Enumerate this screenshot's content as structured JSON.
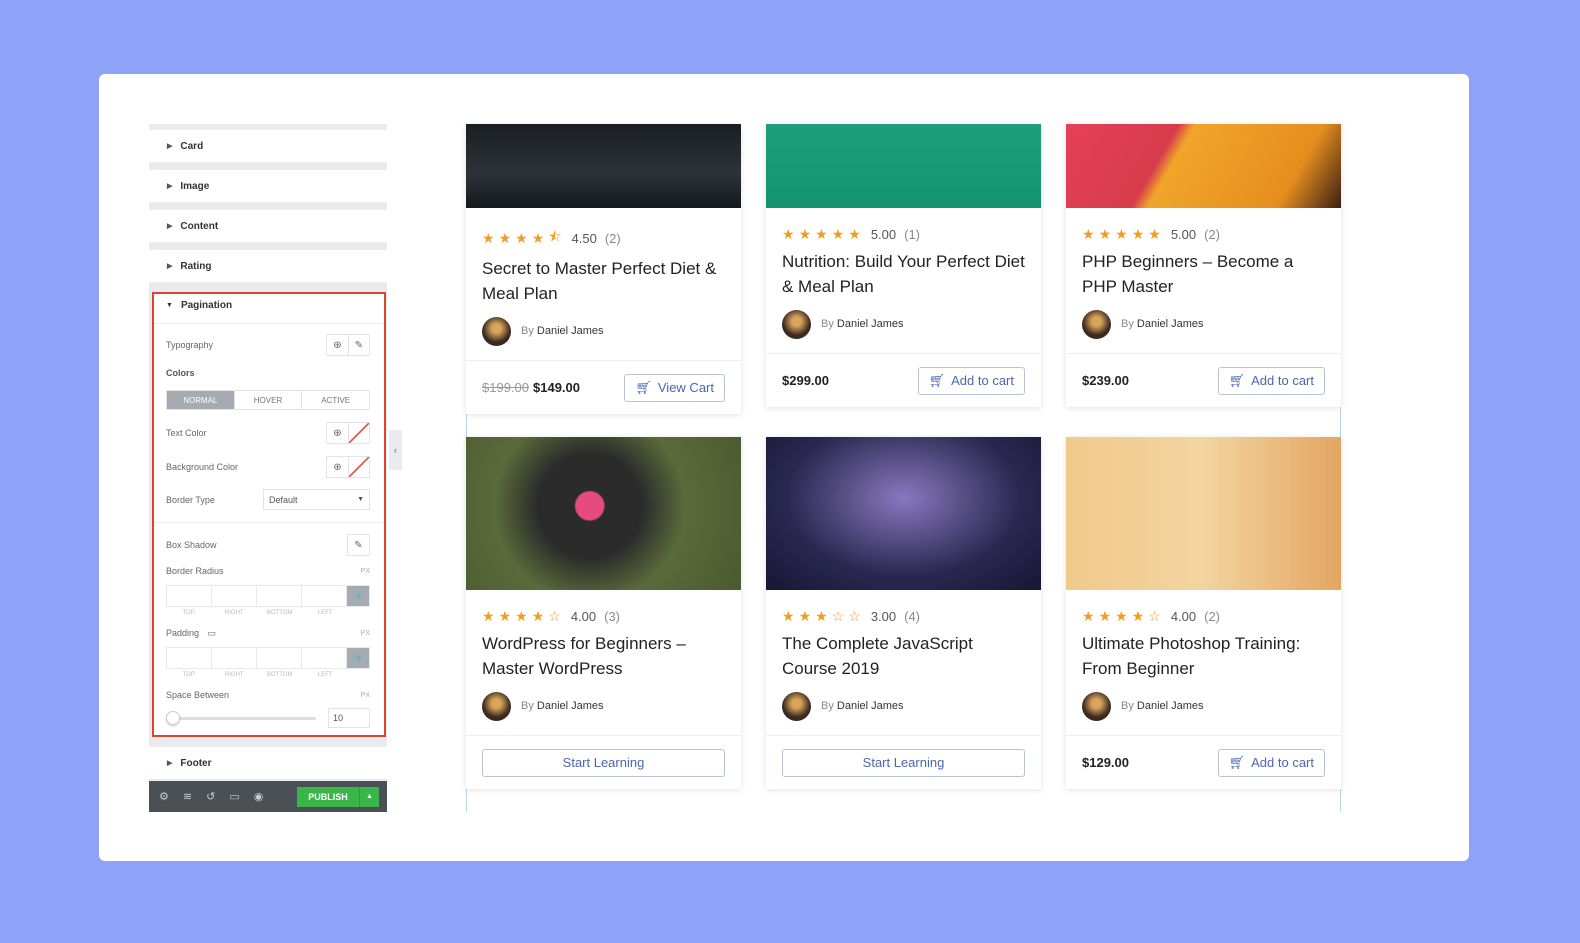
{
  "sidebar": {
    "sections": [
      "Card",
      "Image",
      "Content",
      "Rating"
    ],
    "pagination": {
      "title": "Pagination",
      "typography": "Typography",
      "colors": "Colors",
      "tabs": [
        "NORMAL",
        "HOVER",
        "ACTIVE"
      ],
      "text_color": "Text Color",
      "background_color": "Background Color",
      "border_type": "Border Type",
      "border_type_value": "Default",
      "box_shadow": "Box Shadow",
      "border_radius": "Border Radius",
      "unit": "PX",
      "dim_labels": [
        "TOP",
        "RIGHT",
        "BOTTOM",
        "LEFT"
      ],
      "padding": "Padding",
      "space_between": "Space Between",
      "space_value": "10",
      "space_fraction": 0
    },
    "footer": "Footer",
    "publish": "PUBLISH"
  },
  "courses": [
    {
      "rating": "4.50",
      "stars": 4.5,
      "count": "(2)",
      "title": "Secret to Master Perfect Diet & Meal Plan",
      "by": "By",
      "author": "Daniel James",
      "old_price": "$199.00",
      "price": "$149.00",
      "button": "View Cart",
      "btype": "cart"
    },
    {
      "rating": "5.00",
      "stars": 5,
      "count": "(1)",
      "title": "Nutrition: Build Your Perfect Diet & Meal Plan",
      "by": "By",
      "author": "Daniel James",
      "old_price": "",
      "price": "$299.00",
      "button": "Add to cart",
      "btype": "cart"
    },
    {
      "rating": "5.00",
      "stars": 5,
      "count": "(2)",
      "title": "PHP Beginners – Become a PHP Master",
      "by": "By",
      "author": "Daniel James",
      "old_price": "",
      "price": "$239.00",
      "button": "Add to cart",
      "btype": "cart"
    },
    {
      "rating": "4.00",
      "stars": 4,
      "count": "(3)",
      "title": "WordPress for Beginners – Master WordPress",
      "by": "By",
      "author": "Daniel James",
      "old_price": "",
      "price": "",
      "button": "Start Learning",
      "btype": "wide"
    },
    {
      "rating": "3.00",
      "stars": 3,
      "count": "(4)",
      "title": "The Complete JavaScript Course 2019",
      "by": "By",
      "author": "Daniel James",
      "old_price": "",
      "price": "",
      "button": "Start Learning",
      "btype": "wide"
    },
    {
      "rating": "4.00",
      "stars": 4,
      "count": "(2)",
      "title": "Ultimate Photoshop Training: From Beginner",
      "by": "By",
      "author": "Daniel James",
      "old_price": "",
      "price": "$129.00",
      "button": "Add to cart",
      "btype": "cart"
    }
  ]
}
